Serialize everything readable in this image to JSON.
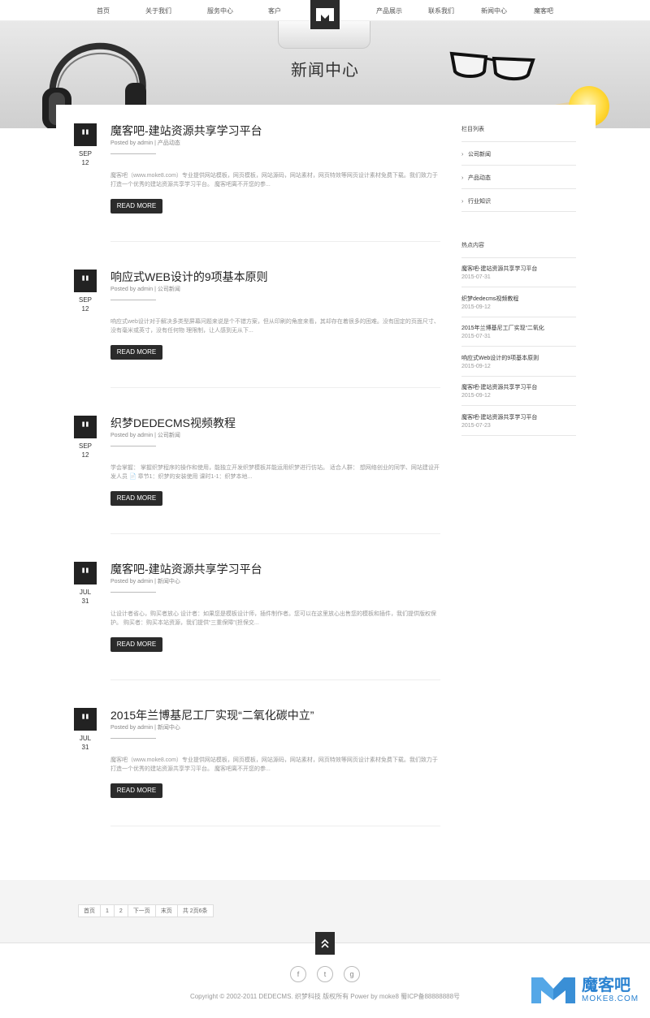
{
  "nav": {
    "items": [
      "首页",
      "关于我们",
      "服务中心",
      "客户",
      "产品展示",
      "联系我们",
      "新闻中心",
      "魔客吧"
    ]
  },
  "banner": {
    "title": "新闻中心"
  },
  "posts": [
    {
      "month": "SEP",
      "day": "12",
      "title": "魔客吧-建站资源共享学习平台",
      "meta": "Posted by admin | 产品动态",
      "excerpt": "魔客吧（www.moke8.com）专业提供网站模板，网页模板，网站源码，网站素材，网页特效等网页设计素材免费下载。我们致力于打造一个优秀的建站资源共享学习平台。 魔客吧离不开您的参...",
      "button": "READ MORE"
    },
    {
      "month": "SEP",
      "day": "12",
      "title": "响应式WEB设计的9项基本原则",
      "meta": "Posted by admin | 公司新闻",
      "excerpt": "响应式web设计对于解决多类型屏幕问题来说是个不错方案，但从印刷的角度来看，其却存在着很多的困难。没有固定的页面尺寸、没有毫米或英寸，没有任何物 理限制，让人感到无从下...",
      "button": "READ MORE"
    },
    {
      "month": "SEP",
      "day": "12",
      "title": "织梦DEDECMS视频教程",
      "meta": "Posted by admin | 公司新闻",
      "excerpt": "学会掌握： 掌握织梦程序的操作和使用，能独立开发织梦模板并能运用织梦进行仿站。 适合人群： 想网络创业的同学、网站建设开发人员 📄 章节1：织梦的安装使用 课时1-1：织梦本地...",
      "button": "READ MORE"
    },
    {
      "month": "JUL",
      "day": "31",
      "title": "魔客吧-建站资源共享学习平台",
      "meta": "Posted by admin | 新闻中心",
      "excerpt": "让设计者省心，购买者放心 设计者：如果您是模板设计师，插件制作者。您可以在这里放心出售您的模板和插件，我们提供版权保护。 购买者：购买本站资源，我们提供“三重保障”(担保交...",
      "button": "READ MORE"
    },
    {
      "month": "JUL",
      "day": "31",
      "title": "2015年兰博基尼工厂实现“二氧化碳中立”",
      "meta": "Posted by admin | 新闻中心",
      "excerpt": "魔客吧（www.moke8.com）专业提供网站模板，网页模板，网站源码，网站素材，网页特效等网页设计素材免费下载。我们致力于打造一个优秀的建站资源共享学习平台。 魔客吧离不开您的参...",
      "button": "READ MORE"
    }
  ],
  "sidebar": {
    "categories_title": "栏目列表",
    "categories": [
      "公司新闻",
      "产品动态",
      "行业知识"
    ],
    "hot_title": "热点内容",
    "hot": [
      {
        "title": "魔客吧-建站资源共享学习平台",
        "date": "2015-07-31"
      },
      {
        "title": "织梦dedecms视频教程",
        "date": "2015-09-12"
      },
      {
        "title": "2015年兰博基尼工厂实现“二氧化",
        "date": "2015-07-31"
      },
      {
        "title": "响应式Web设计的9项基本原则",
        "date": "2015-09-12"
      },
      {
        "title": "魔客吧-建站资源共享学习平台",
        "date": "2015-09-12"
      },
      {
        "title": "魔客吧-建站资源共享学习平台",
        "date": "2015-07-23"
      }
    ]
  },
  "pagination": [
    "首页",
    "1",
    "2",
    "下一页",
    "末页",
    "共 2页6条"
  ],
  "social": {
    "facebook": "f",
    "twitter": "t",
    "google": "g"
  },
  "footer": {
    "copyright": "Copyright © 2002-2011 DEDECMS. 织梦科技 版权所有 Power by moke8  蜀ICP备88888888号"
  },
  "watermark": {
    "cn": "魔客吧",
    "en": "MOKE8.COM"
  },
  "colors": {
    "accent_dark": "#2b2b2b",
    "watermark_blue": "#2c83d1"
  }
}
